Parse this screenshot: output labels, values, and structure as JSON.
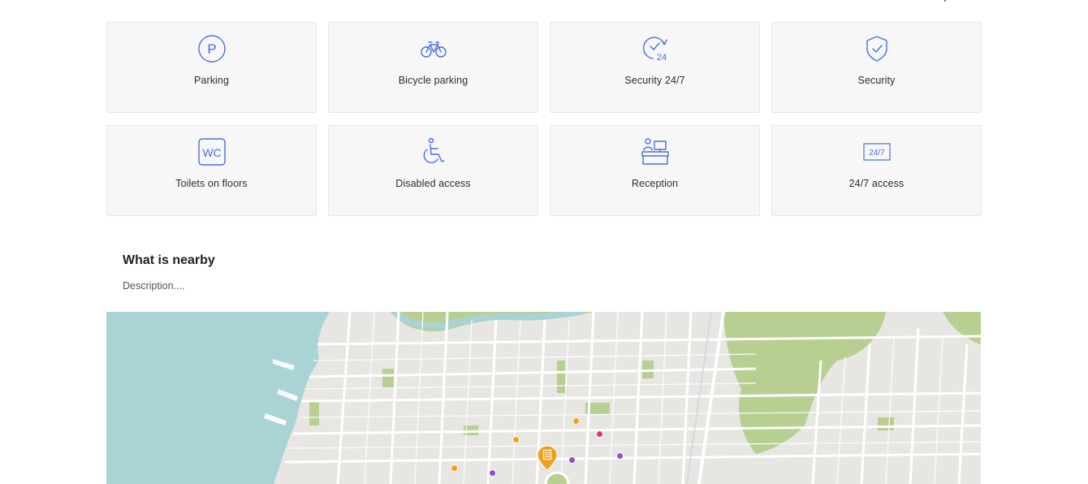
{
  "amenities": [
    {
      "label": "Parking",
      "icon": "parking-icon"
    },
    {
      "label": "Bicycle parking",
      "icon": "bicycle-icon"
    },
    {
      "label": "Security 24/7",
      "icon": "clock-24-icon"
    },
    {
      "label": "Security",
      "icon": "shield-check-icon"
    },
    {
      "label": "Toilets on floors",
      "icon": "wc-icon"
    },
    {
      "label": "Disabled access",
      "icon": "wheelchair-icon"
    },
    {
      "label": "Reception",
      "icon": "reception-desk-icon"
    },
    {
      "label": "24/7 access",
      "icon": "calendar-24-7-icon"
    }
  ],
  "icon_texts": {
    "parking": "P",
    "wc": "WC",
    "clock24": "24",
    "calendar": "24/7"
  },
  "nearby": {
    "title": "What is nearby",
    "description": "Description...."
  },
  "colors": {
    "icon_stroke": "#4a6ee0",
    "card_bg": "#f7f7f7",
    "water": "#a9d3d4",
    "park": "#b8cf92",
    "land": "#e8e6e3",
    "pin": "#f0a11c",
    "poi_orange": "#f0a11c",
    "poi_purple": "#8a4fd6",
    "poi_pink": "#d9367b"
  }
}
